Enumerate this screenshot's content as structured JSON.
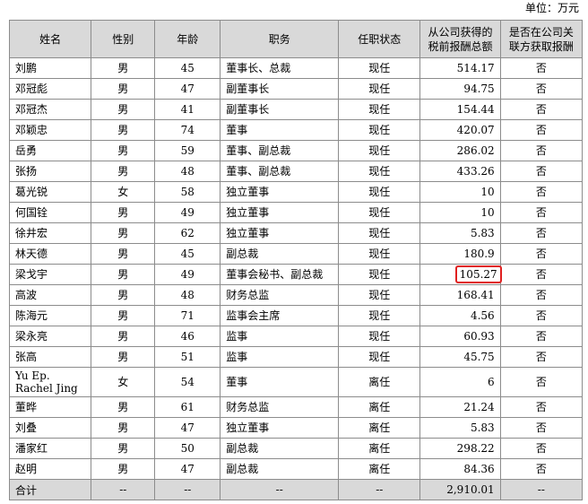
{
  "unit_label": "单位：万元",
  "headers": [
    "姓名",
    "性别",
    "年龄",
    "职务",
    "任职状态",
    "从公司获得的税前报酬总额",
    "是否在公司关联方获取报酬"
  ],
  "rows": [
    [
      "刘鹏",
      "男",
      "45",
      "董事长、总裁",
      "现任",
      "514.17",
      "否"
    ],
    [
      "邓冠彪",
      "男",
      "47",
      "副董事长",
      "现任",
      "94.75",
      "否"
    ],
    [
      "邓冠杰",
      "男",
      "41",
      "副董事长",
      "现任",
      "154.44",
      "否"
    ],
    [
      "邓颖忠",
      "男",
      "74",
      "董事",
      "现任",
      "420.07",
      "否"
    ],
    [
      "岳勇",
      "男",
      "59",
      "董事、副总裁",
      "现任",
      "286.02",
      "否"
    ],
    [
      "张扬",
      "男",
      "48",
      "董事、副总裁",
      "现任",
      "433.26",
      "否"
    ],
    [
      "葛光锐",
      "女",
      "58",
      "独立董事",
      "现任",
      "10",
      "否"
    ],
    [
      "何国铨",
      "男",
      "49",
      "独立董事",
      "现任",
      "10",
      "否"
    ],
    [
      "徐井宏",
      "男",
      "62",
      "独立董事",
      "现任",
      "5.83",
      "否"
    ],
    [
      "林天德",
      "男",
      "45",
      "副总裁",
      "现任",
      "180.9",
      "否"
    ],
    [
      "梁戈宇",
      "男",
      "49",
      "董事会秘书、副总裁",
      "现任",
      "105.27",
      "否"
    ],
    [
      "高波",
      "男",
      "48",
      "财务总监",
      "现任",
      "168.41",
      "否"
    ],
    [
      "陈海元",
      "男",
      "71",
      "监事会主席",
      "现任",
      "4.56",
      "否"
    ],
    [
      "梁永亮",
      "男",
      "46",
      "监事",
      "现任",
      "60.93",
      "否"
    ],
    [
      "张高",
      "男",
      "51",
      "监事",
      "现任",
      "45.75",
      "否"
    ],
    [
      "Yu Ep. Rachel Jing",
      "女",
      "54",
      "董事",
      "离任",
      "6",
      "否"
    ],
    [
      "董晔",
      "男",
      "61",
      "财务总监",
      "离任",
      "21.24",
      "否"
    ],
    [
      "刘叠",
      "男",
      "47",
      "独立董事",
      "离任",
      "5.83",
      "否"
    ],
    [
      "潘家红",
      "男",
      "50",
      "副总裁",
      "离任",
      "298.22",
      "否"
    ],
    [
      "赵明",
      "男",
      "47",
      "副总裁",
      "离任",
      "84.36",
      "否"
    ]
  ],
  "total": [
    "合计",
    "--",
    "--",
    "--",
    "--",
    "2,910.01",
    "--"
  ],
  "highlight_color": "#e02020"
}
